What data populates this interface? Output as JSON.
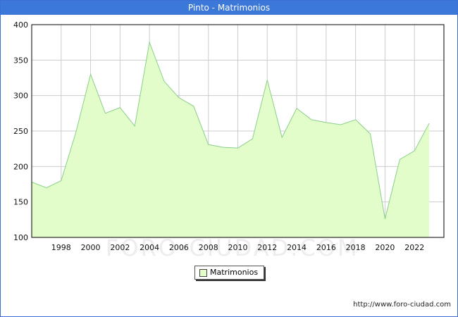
{
  "header": {
    "title": "Pinto - Matrimonios"
  },
  "footer": {
    "url": "http://www.foro-ciudad.com"
  },
  "watermark": "FORO-CIUDAD.COM",
  "chart_data": {
    "type": "area",
    "title": "Pinto - Matrimonios",
    "x": [
      1996,
      1997,
      1998,
      1999,
      2000,
      2001,
      2002,
      2003,
      2004,
      2005,
      2006,
      2007,
      2008,
      2009,
      2010,
      2011,
      2012,
      2013,
      2014,
      2015,
      2016,
      2017,
      2018,
      2019,
      2020,
      2021,
      2022,
      2023
    ],
    "series": [
      {
        "name": "Matrimonios",
        "values": [
          178,
          170,
          180,
          248,
          330,
          275,
          283,
          257,
          375,
          320,
          297,
          285,
          231,
          227,
          226,
          239,
          322,
          241,
          282,
          266,
          262,
          259,
          266,
          246,
          126,
          210,
          222,
          261
        ]
      }
    ],
    "x_ticks": [
      "1998",
      "2000",
      "2002",
      "2004",
      "2006",
      "2008",
      "2010",
      "2012",
      "2014",
      "2016",
      "2018",
      "2020",
      "2022"
    ],
    "y_ticks": [
      "100",
      "150",
      "200",
      "250",
      "300",
      "350",
      "400"
    ],
    "xlim": [
      1996,
      2024
    ],
    "ylim": [
      100,
      400
    ],
    "grid": true,
    "legend_position": "bottom-center",
    "colors": {
      "fill": "#e2fdca",
      "line": "#8acf8a",
      "grid": "#cccccc",
      "title_bar": "#3b78d8"
    }
  }
}
